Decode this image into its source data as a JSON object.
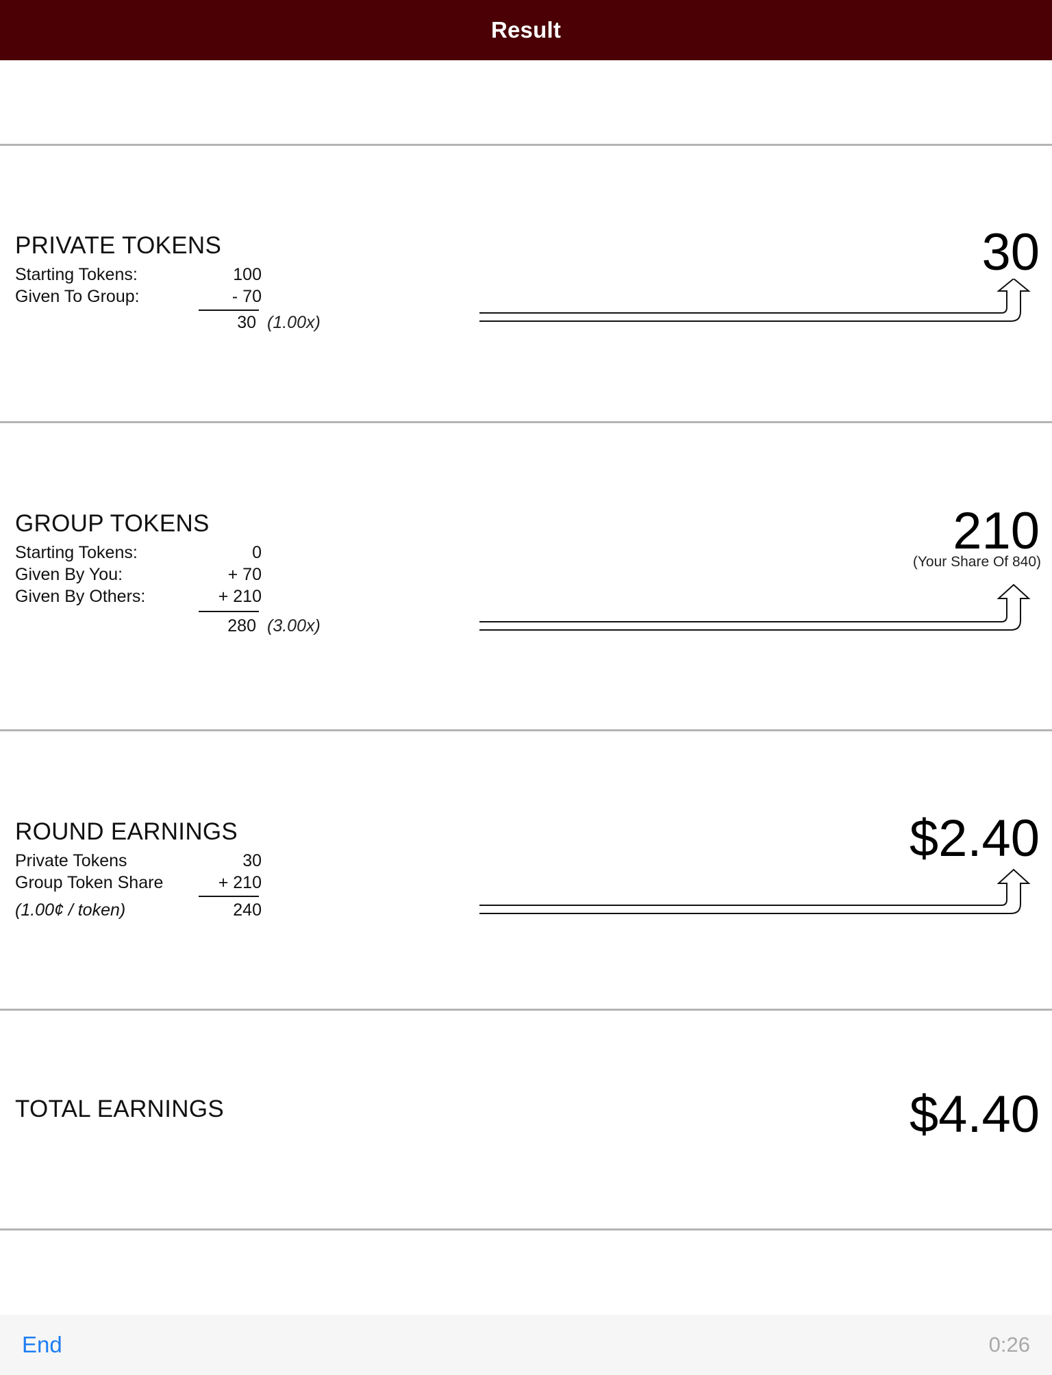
{
  "header": {
    "title": "Result"
  },
  "private_tokens": {
    "title": "PRIVATE TOKENS",
    "rows": [
      {
        "label": "Starting Tokens:",
        "value": "100"
      },
      {
        "label": "Given To Group:",
        "value": "- 70"
      }
    ],
    "total": "30",
    "multiplier": "(1.00x)",
    "result": "30"
  },
  "group_tokens": {
    "title": "GROUP TOKENS",
    "rows": [
      {
        "label": "Starting Tokens:",
        "value": "0"
      },
      {
        "label": "Given By You:",
        "value": "+ 70"
      },
      {
        "label": "Given By Others:",
        "value": "+ 210"
      }
    ],
    "total": "280",
    "multiplier": "(3.00x)",
    "result": "210",
    "result_note": "(Your Share Of 840)"
  },
  "round_earnings": {
    "title": "ROUND EARNINGS",
    "rows": [
      {
        "label": "Private Tokens",
        "value": "30"
      },
      {
        "label": "Group Token Share",
        "value": "+ 210"
      }
    ],
    "rate": "(1.00¢ / token)",
    "total": "240",
    "result": "$2.40"
  },
  "total_earnings": {
    "title": "TOTAL EARNINGS",
    "result": "$4.40"
  },
  "footer": {
    "end_label": "End",
    "timer": "0:26"
  }
}
